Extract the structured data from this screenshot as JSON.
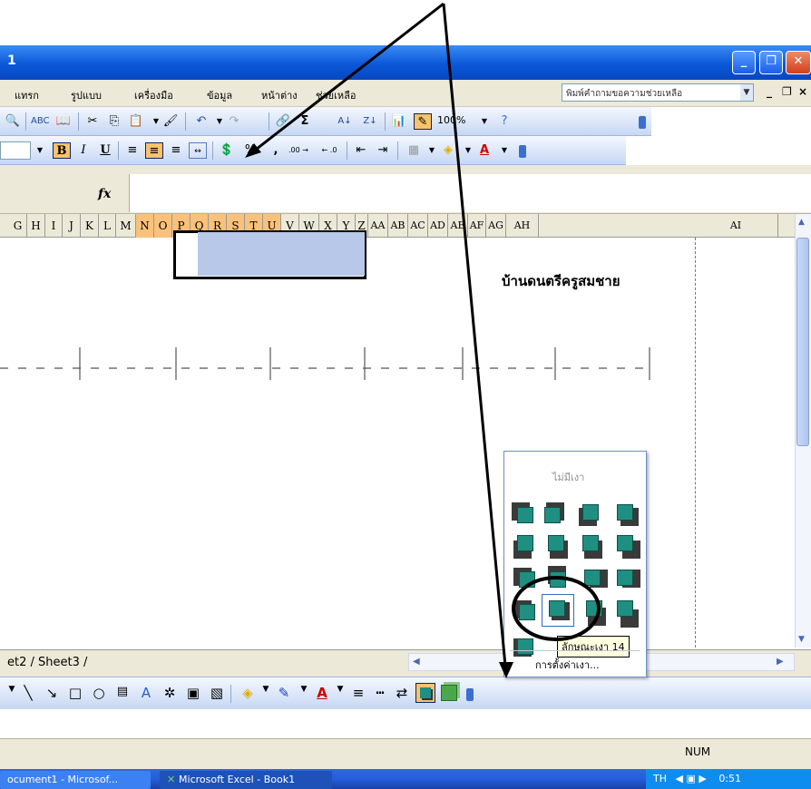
{
  "window": {
    "title_visible": "1"
  },
  "menu": {
    "items": [
      "แทรก",
      "รูปแบบ",
      "เครื่องมือ",
      "ข้อมูล",
      "หน้าต่าง",
      "ช่วยเหลือ"
    ],
    "help_placeholder": "พิมพ์คำถามขอความช่วยเหลือ",
    "mdi_controls": [
      "_",
      "ฮ",
      "×"
    ]
  },
  "standard_toolbar": {
    "zoom": "100%"
  },
  "formatting_toolbar": {
    "bold": "B",
    "italic": "I",
    "underline": "U",
    "percent": "%",
    "comma": ",",
    "inc_decimal": ".00 →",
    "dec_decimal": "← .0"
  },
  "formula_bar": {
    "fx": "fx"
  },
  "columns": [
    "G",
    "H",
    "I",
    "J",
    "K",
    "L",
    "M",
    "N",
    "O",
    "P",
    "Q",
    "R",
    "S",
    "T",
    "U",
    "V",
    "W",
    "X",
    "Y",
    "Z",
    "AA",
    "AB",
    "AC",
    "AD",
    "AE",
    "AF",
    "AG",
    "AH",
    "AI"
  ],
  "selected_columns": [
    "N",
    "O",
    "P",
    "Q",
    "R",
    "S",
    "T",
    "U"
  ],
  "sheet": {
    "title_cell": "บ้านดนตรีครูสมชาย",
    "tabs": "et2 / Sheet3 /"
  },
  "shadow_popup": {
    "no_shadow": "ไม่มีเงา",
    "tooltip": "ลักษณะเงา 14",
    "settings": "การตั้งค่าเงา..."
  },
  "status_bar": {
    "num": "NUM"
  },
  "taskbar": {
    "tasks": [
      "ocument1 - Microsof...",
      "Microsoft Excel - Book1"
    ],
    "lang": "TH",
    "time": "0:51"
  },
  "colors": {
    "title_blue": "#0a58d8",
    "highlight": "#f8c36a",
    "shadow_teal": "#1f8f82"
  }
}
